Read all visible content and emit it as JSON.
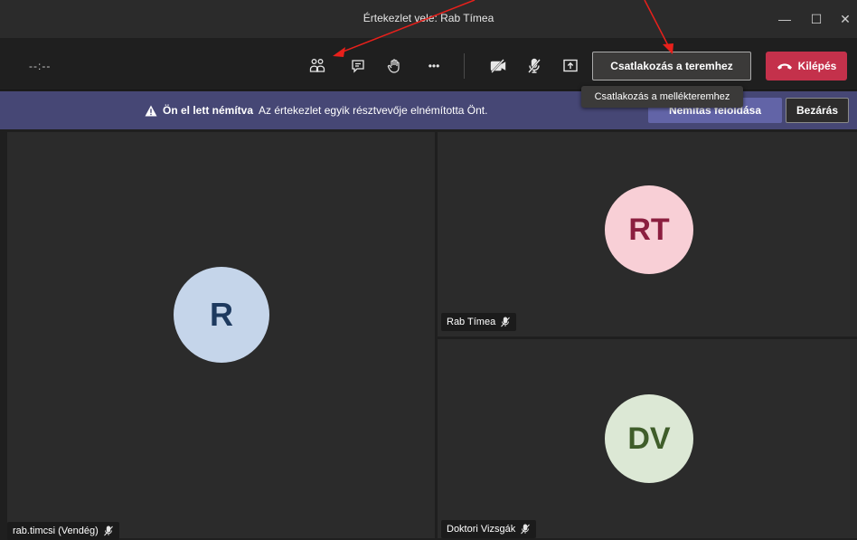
{
  "window": {
    "title": "Értekezlet vele: Rab Tímea",
    "minimize_glyph": "—",
    "maximize_glyph": "☐",
    "close_glyph": "✕"
  },
  "toolbar": {
    "timer": "--:--",
    "participants_icon": "participants-icon",
    "chat_icon": "chat-icon",
    "raise_hand_icon": "raise-hand-icon",
    "more_glyph": "•••",
    "camera_icon": "camera-off-icon",
    "mic_icon": "mic-off-icon",
    "share_icon": "share-screen-icon",
    "join_room_label": "Csatlakozás a teremhez",
    "leave_label": "Kilépés"
  },
  "tooltip": {
    "text": "Csatlakozás a mellékteremhez"
  },
  "notice": {
    "title": "Ön el lett némítva",
    "message": "Az értekezlet egyik résztvevője elnémította Önt.",
    "unmute_label": "Némítás feloldása",
    "close_label": "Bezárás"
  },
  "participants": [
    {
      "initials": "R",
      "name": "rab.timcsi (Vendég)",
      "avatar_bg": "#c5d5ea",
      "avatar_fg": "#1e3a5f"
    },
    {
      "initials": "RT",
      "name": "Rab Tímea",
      "avatar_bg": "#f8cfd6",
      "avatar_fg": "#8b1e3f"
    },
    {
      "initials": "DV",
      "name": "Doktori Vizsgák",
      "avatar_bg": "#dce8d5",
      "avatar_fg": "#3f5d2a"
    }
  ],
  "colors": {
    "accent": "#6264a7",
    "leave": "#c4314b",
    "notice_bg": "#464775",
    "annotation_arrow": "#e8201b"
  }
}
